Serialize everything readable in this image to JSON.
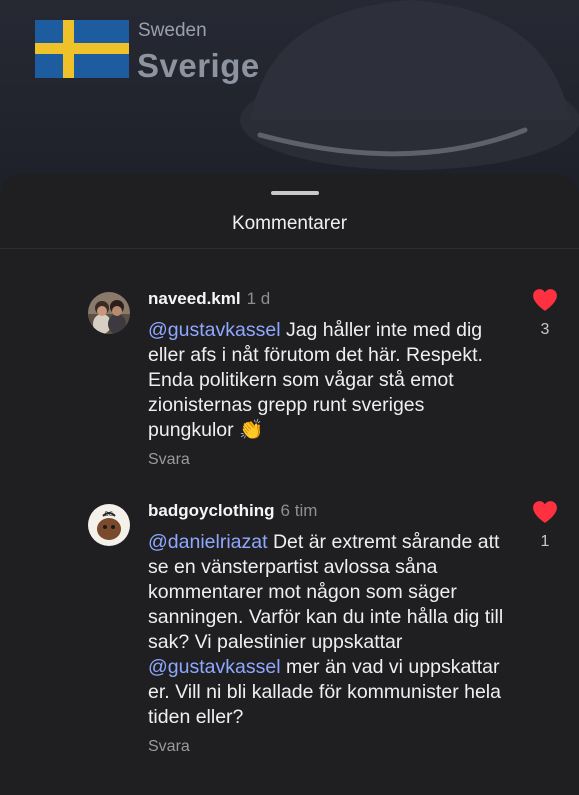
{
  "header": {
    "country_en": "Sweden",
    "country_native": "Sverige"
  },
  "sheet": {
    "title": "Kommentarer"
  },
  "comments": [
    {
      "username": "naveed.kml",
      "time": "1 d",
      "mention": "@gustavkassel",
      "text": " Jag håller inte med dig eller afs i nåt förutom det här. Respekt. Enda politikern som vågar stå emot zionisternas grepp runt sveriges pungkulor 👏",
      "reply_label": "Svara",
      "likes": "3"
    },
    {
      "username": "badgoyclothing",
      "time": "6 tim",
      "mention": "@danielriazat",
      "text_part1": " Det är extremt sårande att se en vänsterpartist avlossa såna kommentarer mot någon som säger sanningen. Varför kan du inte hålla dig till sak? Vi palestinier uppskattar ",
      "mention2": "@gustavkassel",
      "text_part2": " mer än vad vi uppskattar er. Vill ni bli kallade för kommunister hela tiden eller?",
      "reply_label": "Svara",
      "likes": "1"
    }
  ],
  "colors": {
    "mention": "#8fa8ff",
    "heart": "#ff3040",
    "flag_blue": "#1d5c9e",
    "flag_yellow": "#f0c22a"
  },
  "icons": {
    "like": "heart-icon",
    "flag": "sweden-flag-icon"
  }
}
